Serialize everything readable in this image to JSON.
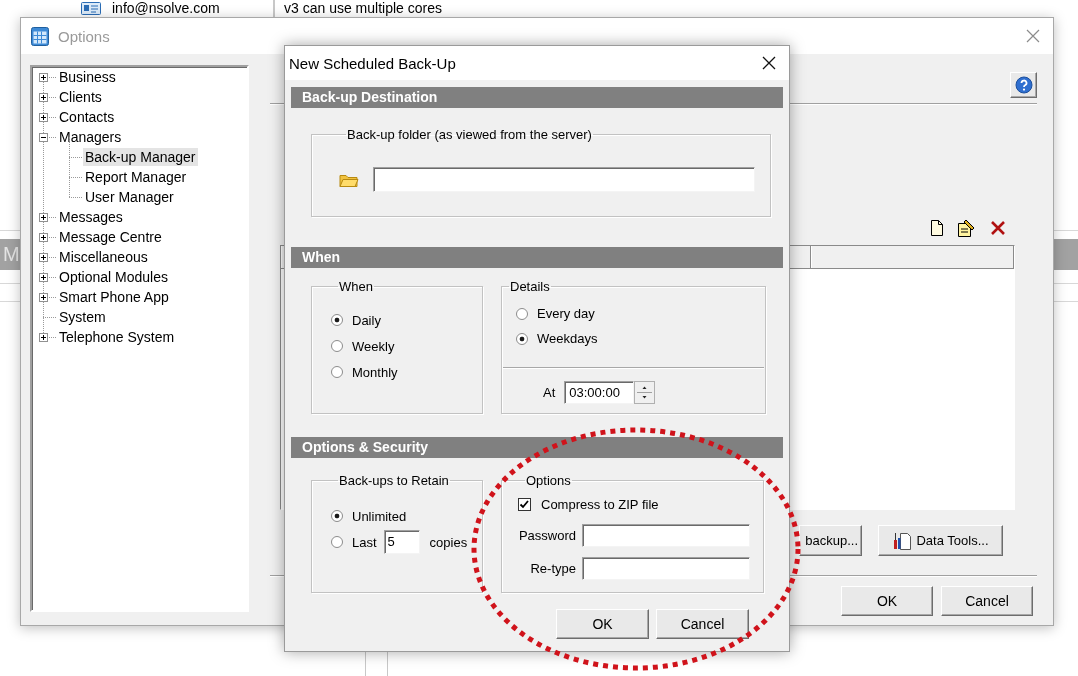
{
  "background": {
    "email": "info@nsolve.com",
    "note": "v3 can use multiple cores",
    "header_text": "M"
  },
  "options_window": {
    "title": "Options",
    "tree": [
      {
        "label": "Business",
        "expanded": false,
        "selected": false
      },
      {
        "label": "Clients",
        "expanded": false,
        "selected": false
      },
      {
        "label": "Contacts",
        "expanded": false,
        "selected": false
      },
      {
        "label": "Managers",
        "expanded": true,
        "selected": false,
        "children": [
          {
            "label": "Back-up Manager",
            "selected": true
          },
          {
            "label": "Report Manager",
            "selected": false
          },
          {
            "label": "User Manager",
            "selected": false
          }
        ]
      },
      {
        "label": "Messages",
        "expanded": false,
        "selected": false
      },
      {
        "label": "Message Centre",
        "expanded": false,
        "selected": false
      },
      {
        "label": "Miscellaneous",
        "expanded": false,
        "selected": false
      },
      {
        "label": "Optional Modules",
        "expanded": false,
        "selected": false
      },
      {
        "label": "Smart Phone App",
        "expanded": false,
        "selected": false
      },
      {
        "label": "System",
        "selected": false
      },
      {
        "label": "Telephone System",
        "expanded": false,
        "selected": false
      }
    ],
    "action_buttons": [
      {
        "label": "backup...",
        "kind": "plain"
      },
      {
        "label": "Data Tools...",
        "kind": "tools"
      }
    ],
    "footer_buttons": [
      "OK",
      "Cancel"
    ]
  },
  "dialog": {
    "title": "New Scheduled Back-Up",
    "destination": {
      "heading": "Back-up Destination",
      "group_label": "Back-up folder (as viewed from the server)"
    },
    "schedule": {
      "heading": "When",
      "frequency": {
        "label": "When",
        "options": [
          {
            "label": "Daily",
            "selected": true
          },
          {
            "label": "Weekly",
            "selected": false
          },
          {
            "label": "Monthly",
            "selected": false
          }
        ]
      },
      "details": {
        "label": "Details",
        "options": [
          {
            "label": "Every day",
            "selected": false
          },
          {
            "label": "Weekdays",
            "selected": true
          }
        ],
        "at_label": "At",
        "time": "03:00:00"
      }
    },
    "security": {
      "heading": "Options & Security",
      "retain": {
        "label": "Back-ups to Retain",
        "options": [
          {
            "label": "Unlimited",
            "selected": true,
            "kind": "plain"
          },
          {
            "label": "Last",
            "selected": false,
            "kind": "count",
            "count": "5",
            "suffix": "copies"
          }
        ]
      },
      "options": {
        "label": "Options",
        "compress": {
          "label": "Compress to ZIP file",
          "checked": true
        },
        "fields": [
          {
            "label": "Password"
          },
          {
            "label": "Re-type"
          }
        ]
      }
    },
    "buttons": [
      "OK",
      "Cancel"
    ]
  }
}
